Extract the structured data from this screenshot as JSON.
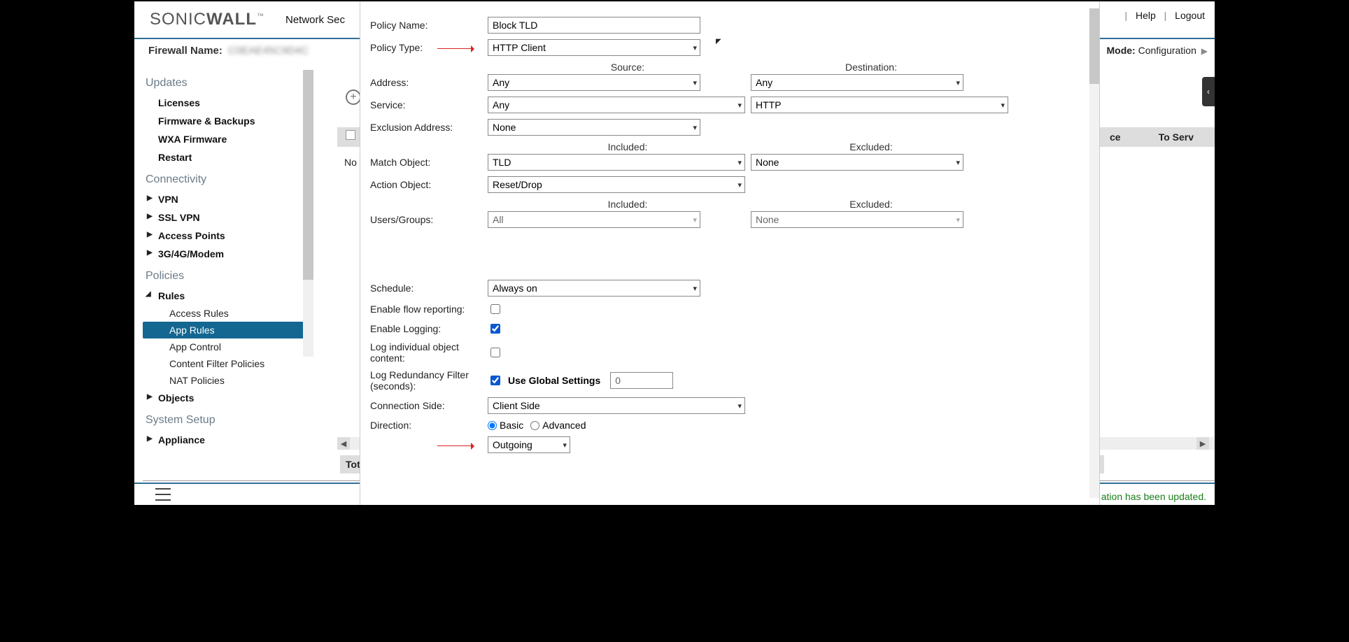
{
  "header": {
    "logo_left": "SONIC",
    "logo_right": "WALL",
    "breadcrumb": "Network Sec",
    "help": "Help",
    "logout": "Logout"
  },
  "firewall": {
    "label": "Firewall Name:",
    "value": "C0EAE45C9D4C",
    "mode_label": "Mode:",
    "mode_value": "Configuration"
  },
  "sidebar": {
    "updates_title": "Updates",
    "items_updates": [
      "Licenses",
      "Firmware & Backups",
      "WXA Firmware",
      "Restart"
    ],
    "connectivity_title": "Connectivity",
    "items_connectivity": [
      "VPN",
      "SSL VPN",
      "Access Points",
      "3G/4G/Modem"
    ],
    "policies_title": "Policies",
    "rules": "Rules",
    "rules_children": [
      "Access Rules",
      "App Rules",
      "App Control",
      "Content Filter Policies",
      "NAT Policies"
    ],
    "objects": "Objects",
    "system_setup": "System Setup",
    "appliance": "Appliance"
  },
  "main_bg": {
    "no_label": "No",
    "th_left": "ce",
    "th_right": "To Serv",
    "total": "Tot",
    "status_msg": "ation has been updated."
  },
  "form": {
    "policy_name_label": "Policy Name:",
    "policy_name_value": "Block TLD",
    "policy_type_label": "Policy Type:",
    "policy_type_value": "HTTP Client",
    "source_hdr": "Source:",
    "destination_hdr": "Destination:",
    "address_label": "Address:",
    "address_src": "Any",
    "address_dst": "Any",
    "service_label": "Service:",
    "service_src": "Any",
    "service_dst": "HTTP",
    "exclusion_address_label": "Exclusion Address:",
    "exclusion_address_value": "None",
    "included_hdr": "Included:",
    "excluded_hdr": "Excluded:",
    "match_object_label": "Match Object:",
    "match_object_inc": "TLD",
    "match_object_exc": "None",
    "action_object_label": "Action Object:",
    "action_object_value": "Reset/Drop",
    "users_groups_label": "Users/Groups:",
    "users_groups_inc": "All",
    "users_groups_exc": "None",
    "schedule_label": "Schedule:",
    "schedule_value": "Always on",
    "enable_flow_label": "Enable flow reporting:",
    "enable_logging_label": "Enable Logging:",
    "log_individual_label": "Log individual object content:",
    "log_redundancy_label": "Log Redundancy Filter (seconds):",
    "use_global_label": "Use Global Settings",
    "use_global_value": "0",
    "connection_side_label": "Connection Side:",
    "connection_side_value": "Client Side",
    "direction_label": "Direction:",
    "direction_basic": "Basic",
    "direction_advanced": "Advanced",
    "direction_value": "Outgoing"
  }
}
